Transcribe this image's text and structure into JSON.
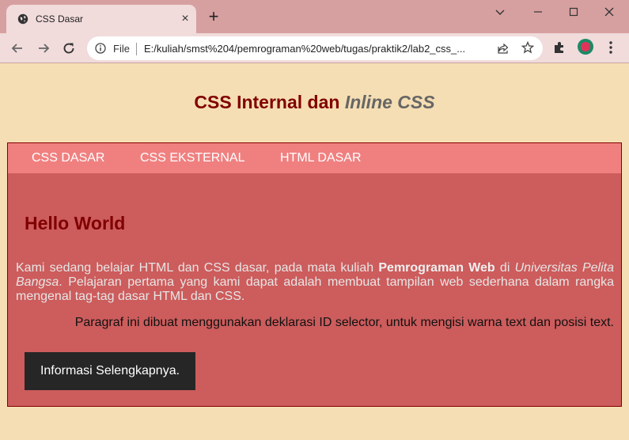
{
  "browser": {
    "tab_title": "CSS Dasar",
    "tab_close": "×",
    "new_tab": "+",
    "address": {
      "security_label": "File",
      "url": "E:/kuliah/smst%204/pemrograman%20web/tugas/praktik2/lab2_css_..."
    },
    "icons": [
      "globe-icon",
      "close-icon",
      "plus-icon",
      "minimize-icon",
      "maximize-icon",
      "window-close-icon",
      "back-icon",
      "forward-icon",
      "reload-icon",
      "info-icon",
      "share-icon",
      "star-icon",
      "extensions-icon",
      "profile-icon",
      "menu-icon"
    ]
  },
  "page": {
    "heading_part1": "CSS Internal dan ",
    "heading_italic": "Inline",
    "heading_part2": " CSS",
    "nav_items": [
      {
        "label": "CSS DASAR"
      },
      {
        "label": "CSS EKSTERNAL"
      },
      {
        "label": "HTML DASAR"
      }
    ],
    "content": {
      "title": "Hello World",
      "para_part1": "Kami sedang belajar HTML dan CSS dasar, pada mata kuliah ",
      "para_bold": "Pemrograman Web",
      "para_part2": " di ",
      "para_italic": "Universitas Pelita Bangsa",
      "para_part3": ". Pelajaran pertama yang kami dapat adalah membuat tampilan web sederhana dalam rangka mengenal tag-tag dasar HTML dan CSS.",
      "id_paragraph": "Paragraf ini dibuat menggunakan deklarasi ID selector, untuk mengisi warna text dan posisi text.",
      "button_label": "Informasi Selengkapnya."
    }
  },
  "colors": {
    "page_bg": "#f5deb3",
    "heading": "#800000",
    "heading_italic": "#666666",
    "nav_bg": "#f08080",
    "content_bg": "#cd5c5c",
    "button_bg": "#262626"
  }
}
